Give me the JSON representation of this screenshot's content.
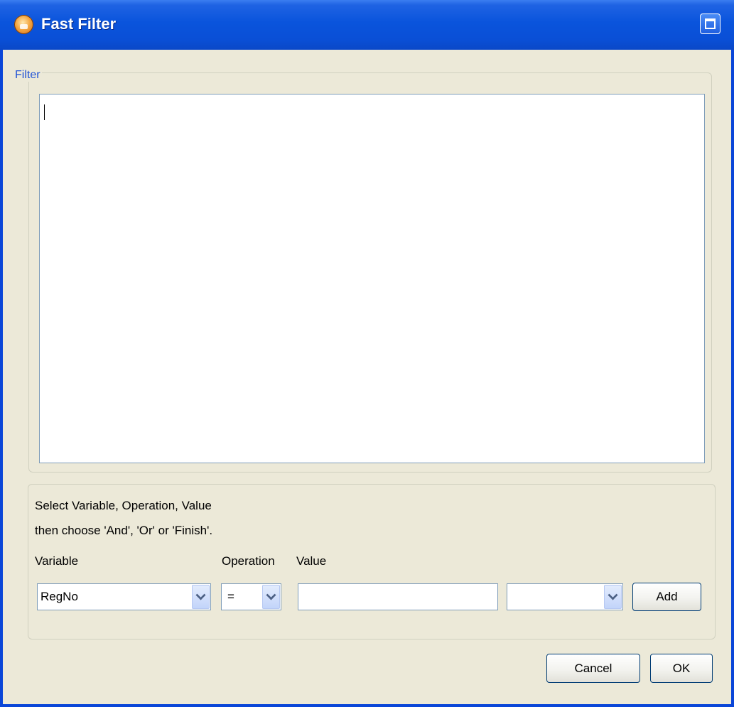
{
  "window": {
    "title": "Fast Filter",
    "title_color": "#ffffff",
    "titlebar_color": "#0a54dc",
    "client_background": "#ece9d8"
  },
  "filter_group": {
    "legend": "Filter",
    "legend_color": "#1f52d6",
    "text_value": ""
  },
  "builder": {
    "instruction_line1": "Select Variable, Operation, Value",
    "instruction_line2": "then choose 'And', 'Or' or 'Finish'.",
    "variable_label": "Variable",
    "operation_label": "Operation",
    "value_label": "Value",
    "variable_selected": "RegNo",
    "operation_selected": "=",
    "value_text": "",
    "value_combo_selected": "",
    "add_label": "Add"
  },
  "footer": {
    "cancel_label": "Cancel",
    "ok_label": "OK"
  },
  "icons": [
    "app-icon",
    "maximize-icon",
    "dropdown-arrow-icon"
  ]
}
